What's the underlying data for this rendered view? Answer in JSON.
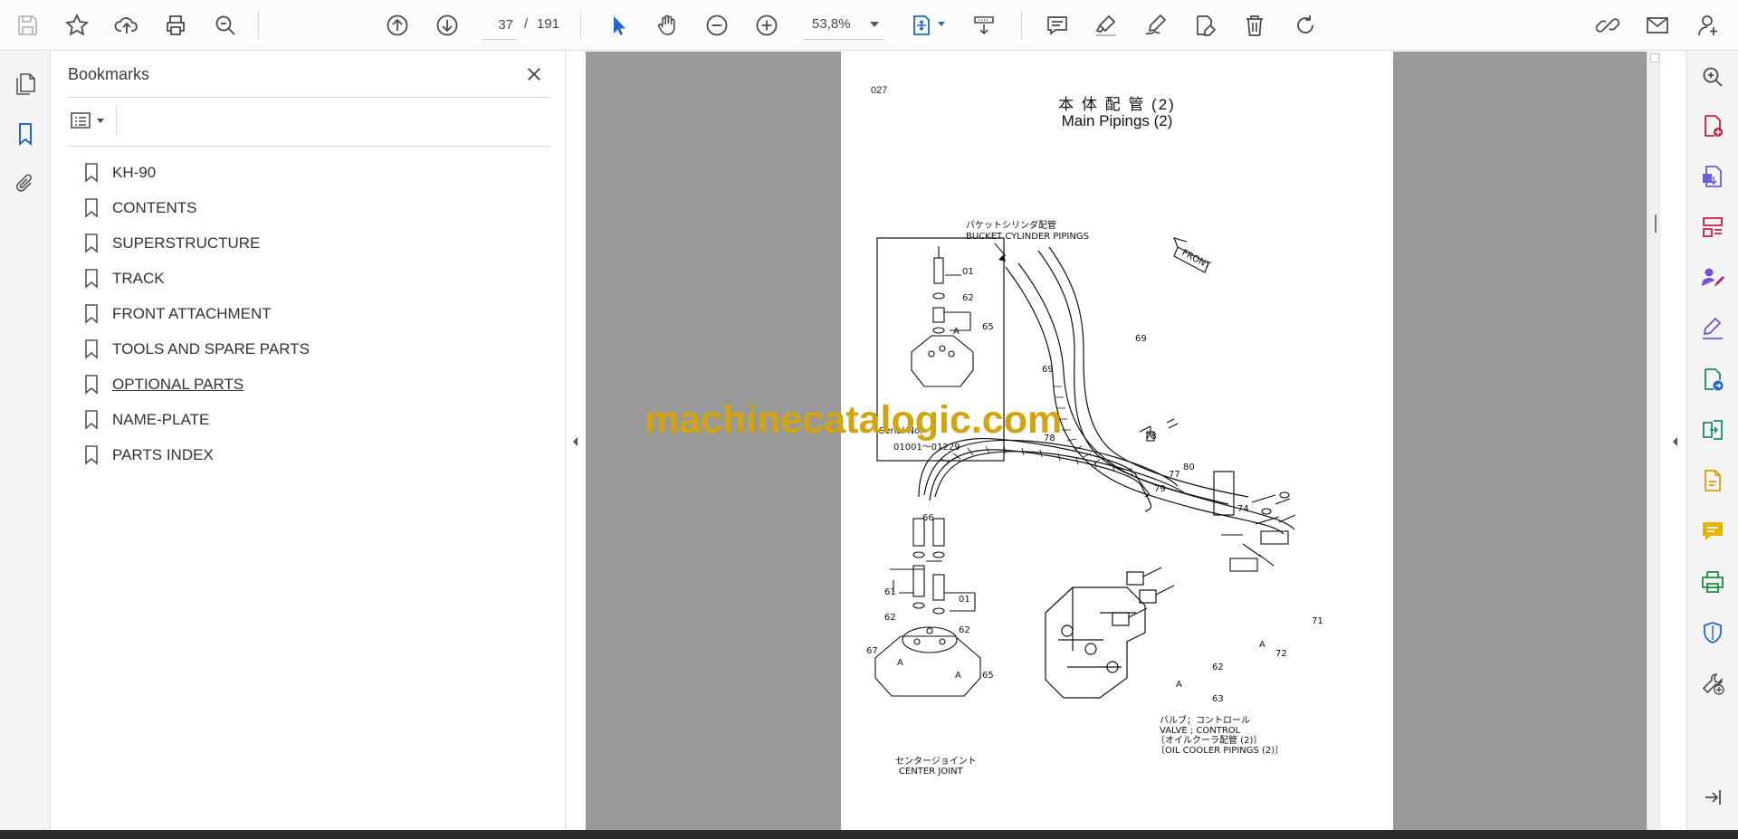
{
  "toolbar": {
    "current_page": "37",
    "page_separator": "/",
    "total_pages": "191",
    "zoom": "53,8%"
  },
  "bookmarks": {
    "title": "Bookmarks",
    "items": [
      {
        "label": "KH-90"
      },
      {
        "label": "CONTENTS"
      },
      {
        "label": "SUPERSTRUCTURE"
      },
      {
        "label": "TRACK"
      },
      {
        "label": "FRONT ATTACHMENT"
      },
      {
        "label": "TOOLS AND SPARE PARTS"
      },
      {
        "label": "OPTIONAL PARTS"
      },
      {
        "label": "NAME-PLATE"
      },
      {
        "label": "PARTS INDEX"
      }
    ],
    "active_index": 6
  },
  "document": {
    "page_number": "027",
    "title_jp": "本 体 配 管 (2)",
    "title_en": "Main Pipings (2)",
    "labels": {
      "bucket_jp": "バケットシリンダ配管",
      "bucket_en": "BUCKET CYLINDER PIPINGS",
      "front": "FRONT",
      "serial_no": "Serial No.",
      "serial_range": "01001～01229",
      "valve_jp": "バルブ；コントロール",
      "valve_en": "VALVE ; CONTROL",
      "cooler_jp": "〔オイルクーラ配管 (2)〕",
      "cooler_en": "〔OIL COOLER PIPINGS (2)〕",
      "joint_jp": "センタージョイント",
      "joint_en": "CENTER JOINT",
      "n01": "01",
      "n62": "62",
      "n65": "65",
      "nA": "A",
      "n69": "69",
      "n78": "78",
      "n77": "77",
      "n80": "80",
      "n79": "79",
      "n74": "74",
      "n66": "66",
      "n61": "61",
      "n67": "67",
      "n71": "71",
      "n72": "72",
      "n63": "63"
    }
  },
  "watermark": "machinecatalogic.com",
  "colors": {
    "accent": "#2166d1",
    "viewer_bg": "#999999",
    "watermark": "#d1a410",
    "export_red": "#d4193e",
    "purple": "#7a4fe0",
    "pink": "#b8237a"
  },
  "icons": {
    "toolbar": [
      "save-icon",
      "star-icon",
      "upload-icon",
      "print-icon",
      "zoom-search-icon",
      "page-up-icon",
      "page-down-icon",
      "select-cursor-icon",
      "hand-icon",
      "zoom-out-icon",
      "zoom-in-icon",
      "fit-page-icon",
      "scroll-mode-icon",
      "comment-icon",
      "highlight-icon",
      "sign-icon",
      "edit-pdf-icon",
      "delete-icon",
      "rotate-icon",
      "share-link-icon",
      "mail-icon",
      "account-icon"
    ],
    "left_rail": [
      "pages-icon",
      "bookmark-icon",
      "attachment-icon"
    ],
    "right_rail": [
      "search-zoom-icon",
      "export-pdf-icon",
      "create-pdf-icon",
      "organize-pages-icon",
      "request-sign-icon",
      "fill-sign-icon",
      "convert-pdf-icon",
      "combine-files-icon",
      "edit-doc-icon",
      "comment-tool-icon",
      "scan-icon",
      "protect-icon",
      "more-tools-icon",
      "expand-panel-icon"
    ]
  }
}
